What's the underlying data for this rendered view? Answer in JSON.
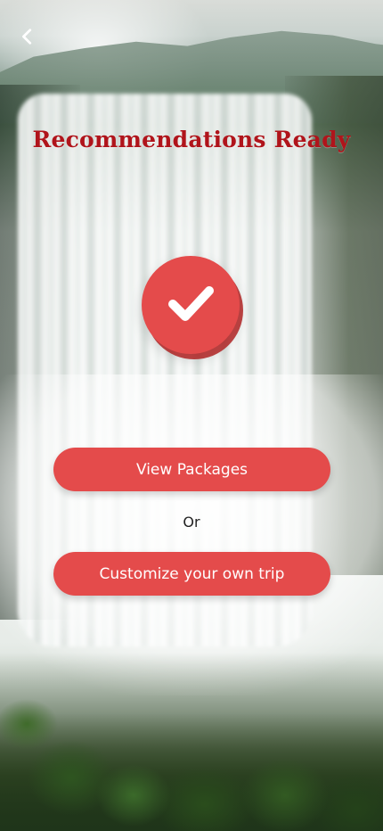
{
  "header": {
    "back_icon": "chevron-left-icon"
  },
  "main": {
    "title": "Recommendations Ready",
    "status_icon": "checkmark-icon",
    "primary_button_label": "View Packages",
    "separator_text": "Or",
    "secondary_button_label": "Customize your own trip"
  },
  "colors": {
    "accent": "#e44b4b",
    "title": "#b0141b"
  }
}
